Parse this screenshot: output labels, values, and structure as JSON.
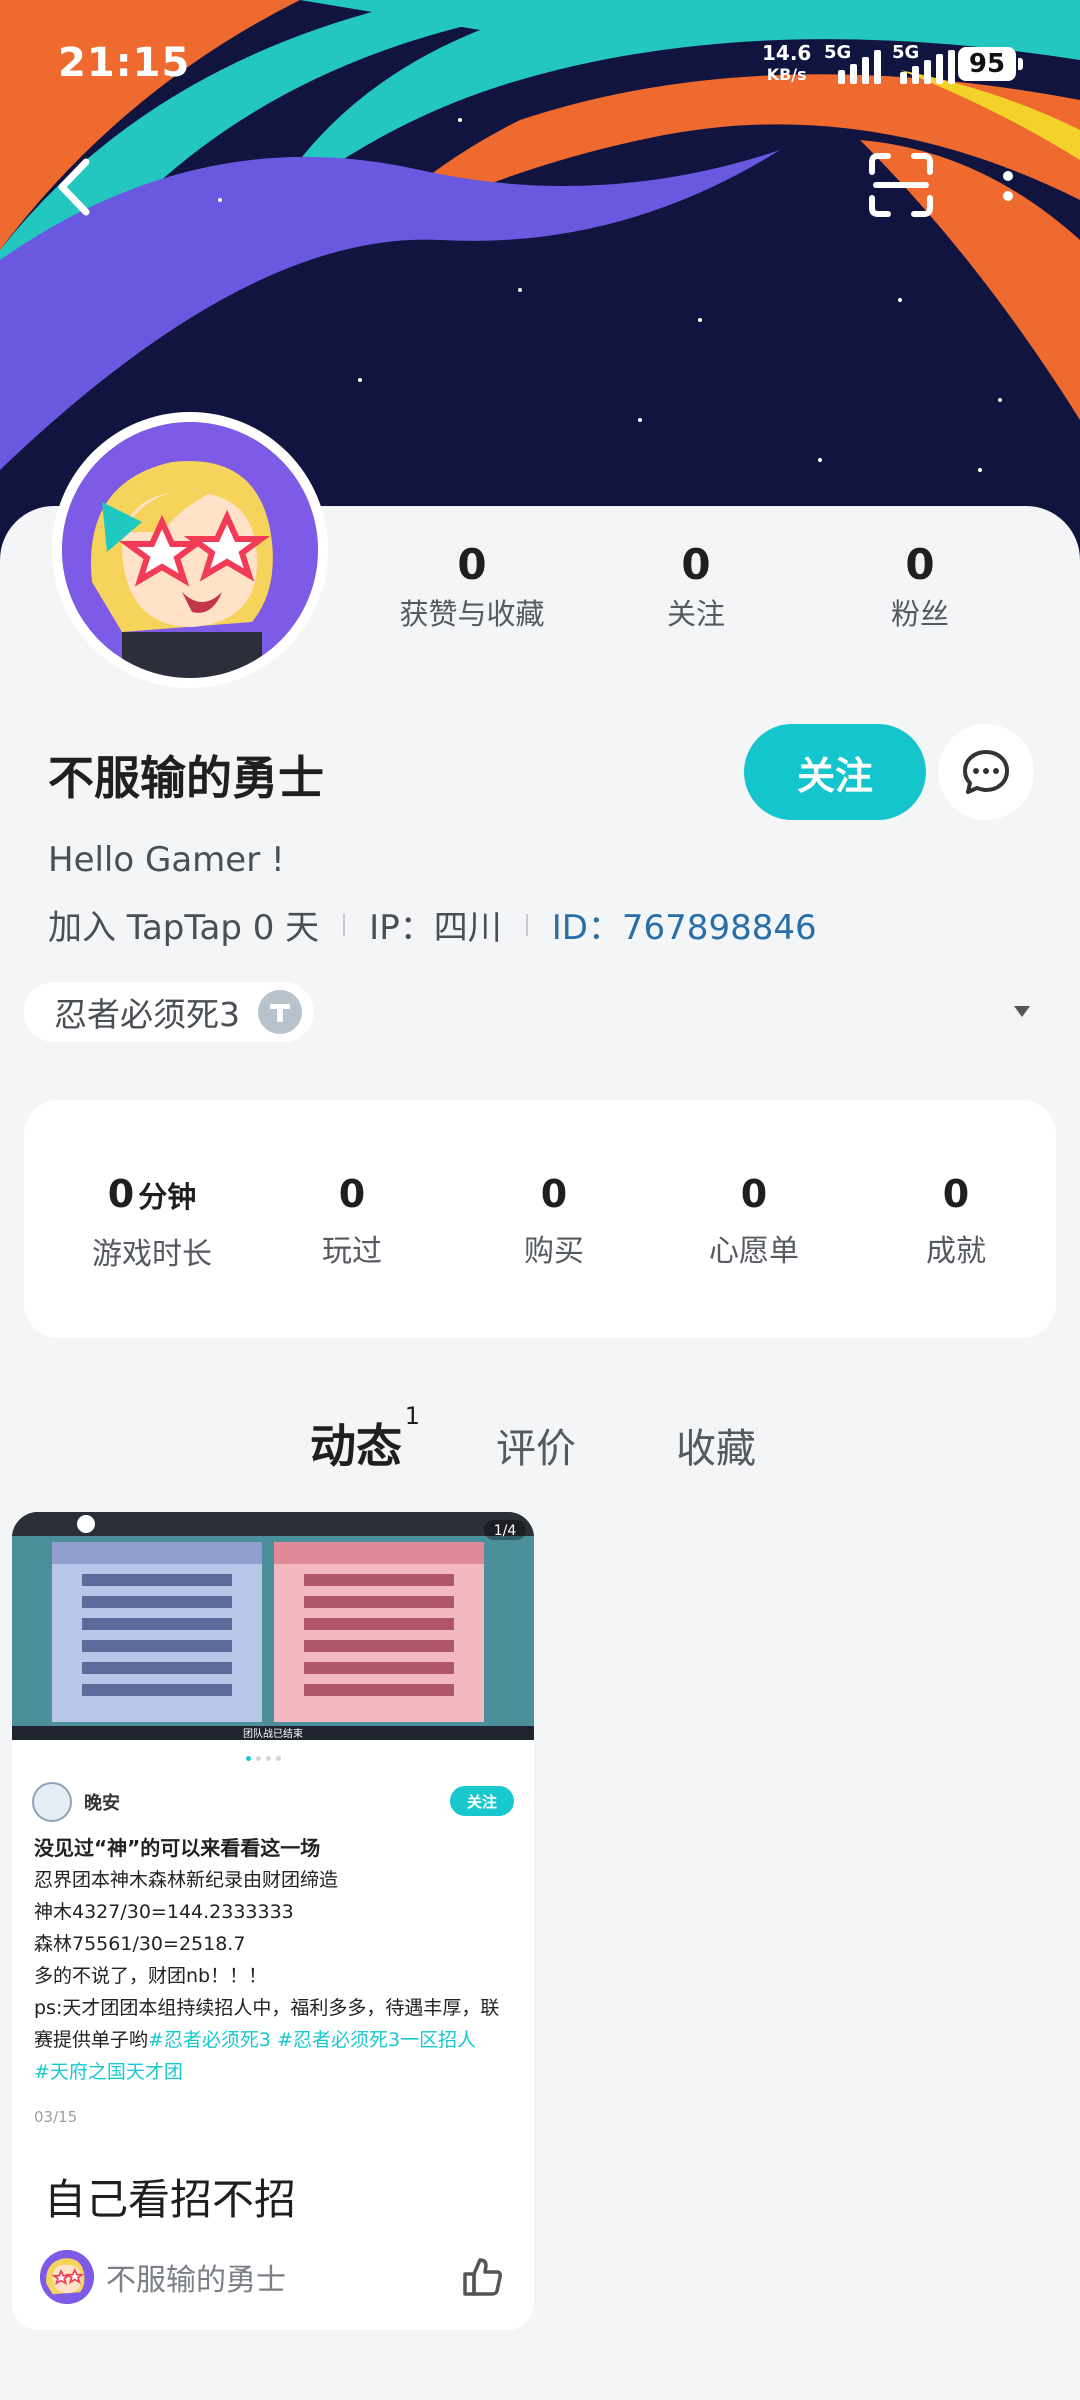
{
  "status_bar": {
    "time": "21:15",
    "speed_value": "14.6",
    "speed_unit": "KB/s",
    "net1": "5G",
    "net2": "5G",
    "battery": "95"
  },
  "profile": {
    "username": "不服输的勇士",
    "bio": "Hello Gamer !",
    "joined": "加入 TapTap 0 天",
    "ip": "IP：四川",
    "id": "ID：767898846",
    "follow_label": "关注"
  },
  "stats": [
    {
      "value": "0",
      "label": "获赞与收藏"
    },
    {
      "value": "0",
      "label": "关注"
    },
    {
      "value": "0",
      "label": "粉丝"
    }
  ],
  "game_tag": {
    "label": "忍者必须死3"
  },
  "summary": [
    {
      "value": "0",
      "unit": "分钟",
      "label": "游戏时长"
    },
    {
      "value": "0",
      "unit": "",
      "label": "玩过"
    },
    {
      "value": "0",
      "unit": "",
      "label": "购买"
    },
    {
      "value": "0",
      "unit": "",
      "label": "心愿单"
    },
    {
      "value": "0",
      "unit": "",
      "label": "成就"
    }
  ],
  "tabs": [
    {
      "label": "动态",
      "badge": "1"
    },
    {
      "label": "评价",
      "badge": ""
    },
    {
      "label": "收藏",
      "badge": ""
    }
  ],
  "post": {
    "image_counter": "1/4",
    "author_name": "晚安",
    "follow_label": "关注",
    "title": "没见过“神”的可以来看看这一场",
    "lines": [
      "忍界团本神木森林新纪录由财团缔造",
      "神木4327/30=144.2333333",
      "森林75561/30=2518.7",
      "多的不说了，财团nb！！！",
      "ps:天才团团本组持续招人中，福利多多，待遇丰厚，联赛提供单子哟"
    ],
    "tag1": "#忍者必须死3",
    "tag2": "#忍者必须死3一区招人",
    "tag3": "#天府之国天才团",
    "date": "03/15",
    "caption": "自己看招不招",
    "poster_name": "不服输的勇士",
    "board_text": "团队战已结束"
  },
  "colors": {
    "accent": "#19c8cf",
    "id_link": "#2a6ea8",
    "banner_bg": "#141640"
  }
}
